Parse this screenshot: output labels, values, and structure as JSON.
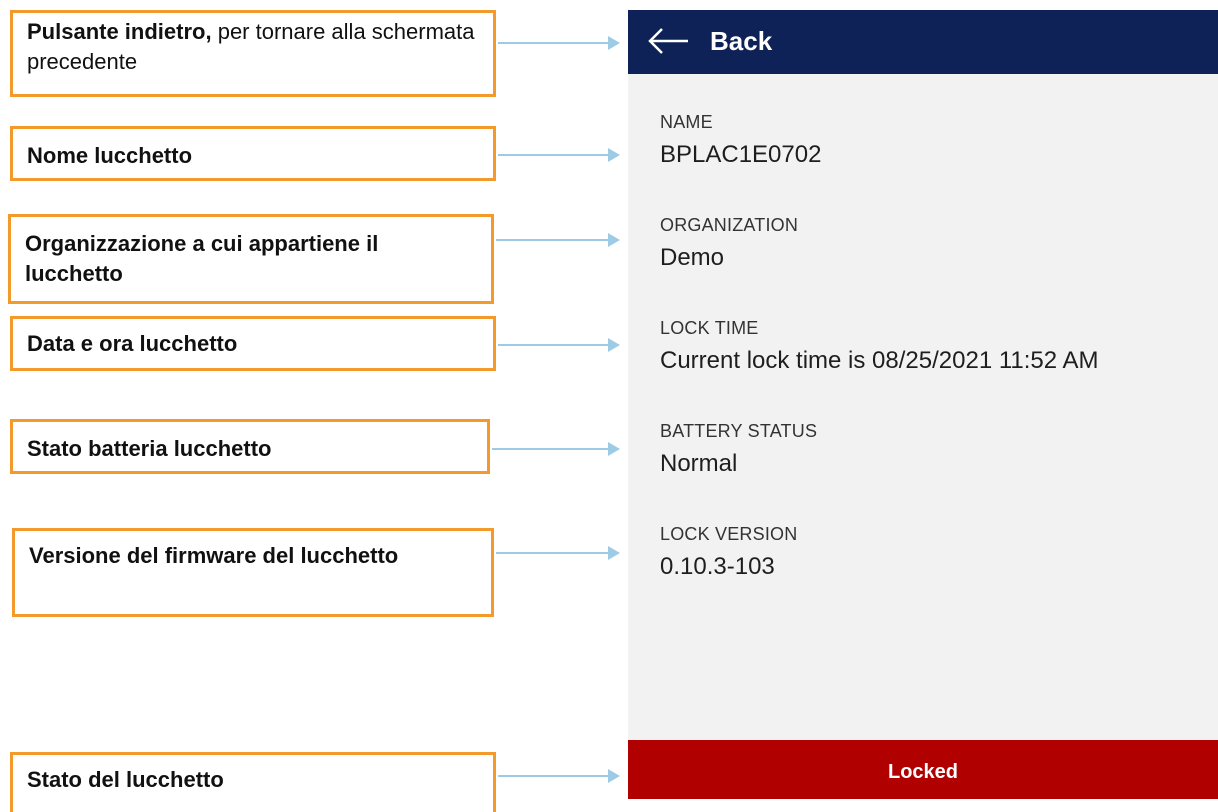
{
  "annotations": [
    {
      "bold": "Pulsante indietro,",
      "rest": " per tornare alla schermata precedente"
    },
    {
      "bold": "Nome lucchetto",
      "rest": ""
    },
    {
      "bold": "Organizzazione a cui appartiene il lucchetto",
      "rest": ""
    },
    {
      "bold": "Data e ora lucchetto",
      "rest": ""
    },
    {
      "bold": "Stato batteria lucchetto",
      "rest": ""
    },
    {
      "bold": "Versione del firmware del lucchetto",
      "rest": ""
    },
    {
      "bold": "Stato del lucchetto",
      "rest": ""
    }
  ],
  "appbar": {
    "back_icon": "arrow-left-icon",
    "back_label": "Back"
  },
  "fields": [
    {
      "label": "NAME",
      "value": "BPLAC1E0702"
    },
    {
      "label": "ORGANIZATION",
      "value": "Demo"
    },
    {
      "label": "LOCK TIME",
      "value": "Current lock time is 08/25/2021 11:52 AM"
    },
    {
      "label": "BATTERY STATUS",
      "value": "Normal"
    },
    {
      "label": "LOCK VERSION",
      "value": "0.10.3-103"
    }
  ],
  "status": {
    "label": "Locked"
  },
  "colors": {
    "appbar": "#0f2257",
    "status": "#b00000",
    "callout_border": "#f39a2b",
    "arrow": "#9dcbe6"
  }
}
